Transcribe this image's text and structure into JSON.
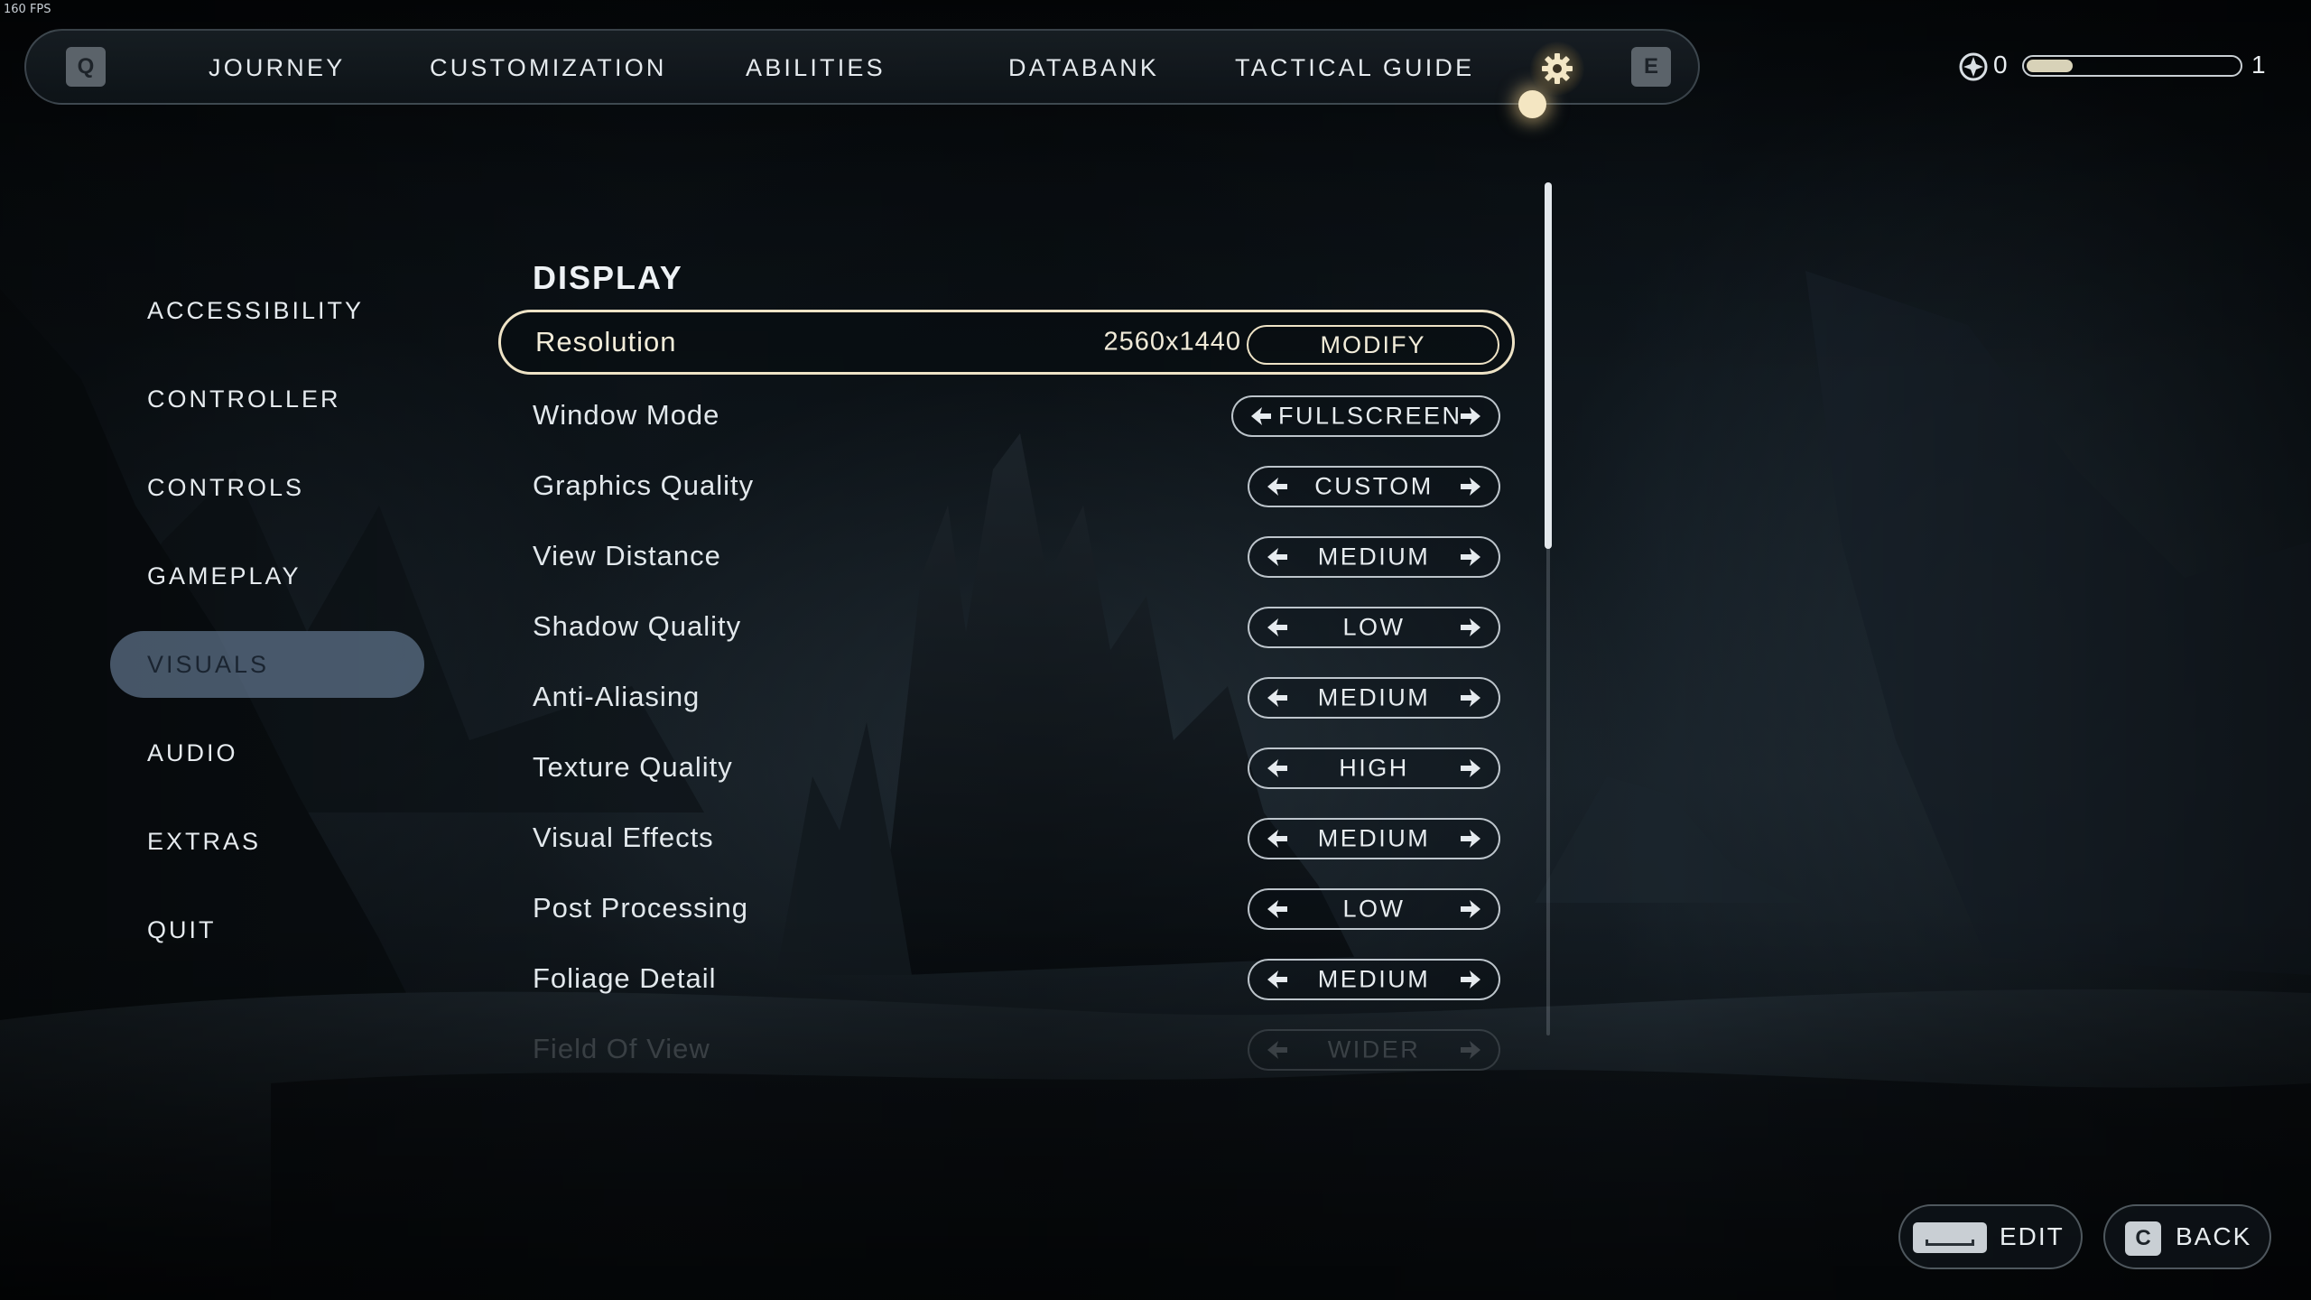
{
  "fps_counter": "160 FPS",
  "top_nav": {
    "left_key": "Q",
    "right_key": "E",
    "tabs": [
      {
        "label": "JOURNEY"
      },
      {
        "label": "CUSTOMIZATION"
      },
      {
        "label": "ABILITIES"
      },
      {
        "label": "DATABANK"
      },
      {
        "label": "TACTICAL GUIDE"
      }
    ],
    "active_tab_icon": "gear-icon"
  },
  "xp": {
    "points": "0",
    "next_level": "1",
    "progress": 0.22
  },
  "sidebar": {
    "active_index": 4,
    "items": [
      {
        "label": "ACCESSIBILITY"
      },
      {
        "label": "CONTROLLER"
      },
      {
        "label": "CONTROLS"
      },
      {
        "label": "GAMEPLAY"
      },
      {
        "label": "VISUALS"
      },
      {
        "label": "AUDIO"
      },
      {
        "label": "EXTRAS"
      },
      {
        "label": "QUIT"
      }
    ]
  },
  "section": {
    "title": "DISPLAY"
  },
  "settings": {
    "resolution": {
      "label": "Resolution",
      "value": "2560x1440",
      "button": "MODIFY"
    },
    "rows": [
      {
        "label": "Window Mode",
        "value": "FULLSCREEN"
      },
      {
        "label": "Graphics Quality",
        "value": "CUSTOM"
      },
      {
        "label": "View Distance",
        "value": "MEDIUM"
      },
      {
        "label": "Shadow Quality",
        "value": "LOW"
      },
      {
        "label": "Anti-Aliasing",
        "value": "MEDIUM"
      },
      {
        "label": "Texture Quality",
        "value": "HIGH"
      },
      {
        "label": "Visual Effects",
        "value": "MEDIUM"
      },
      {
        "label": "Post Processing",
        "value": "LOW"
      },
      {
        "label": "Foliage Detail",
        "value": "MEDIUM"
      },
      {
        "label": "Field Of View",
        "value": "WIDER"
      }
    ]
  },
  "bottom_actions": {
    "edit": {
      "label": "EDIT",
      "key": "space-key-icon"
    },
    "back": {
      "label": "BACK",
      "key": "C"
    }
  },
  "colors": {
    "accent_gold": "#eee3c6",
    "active_sidebar": "#6e84a0",
    "text": "#e2e8ec"
  }
}
